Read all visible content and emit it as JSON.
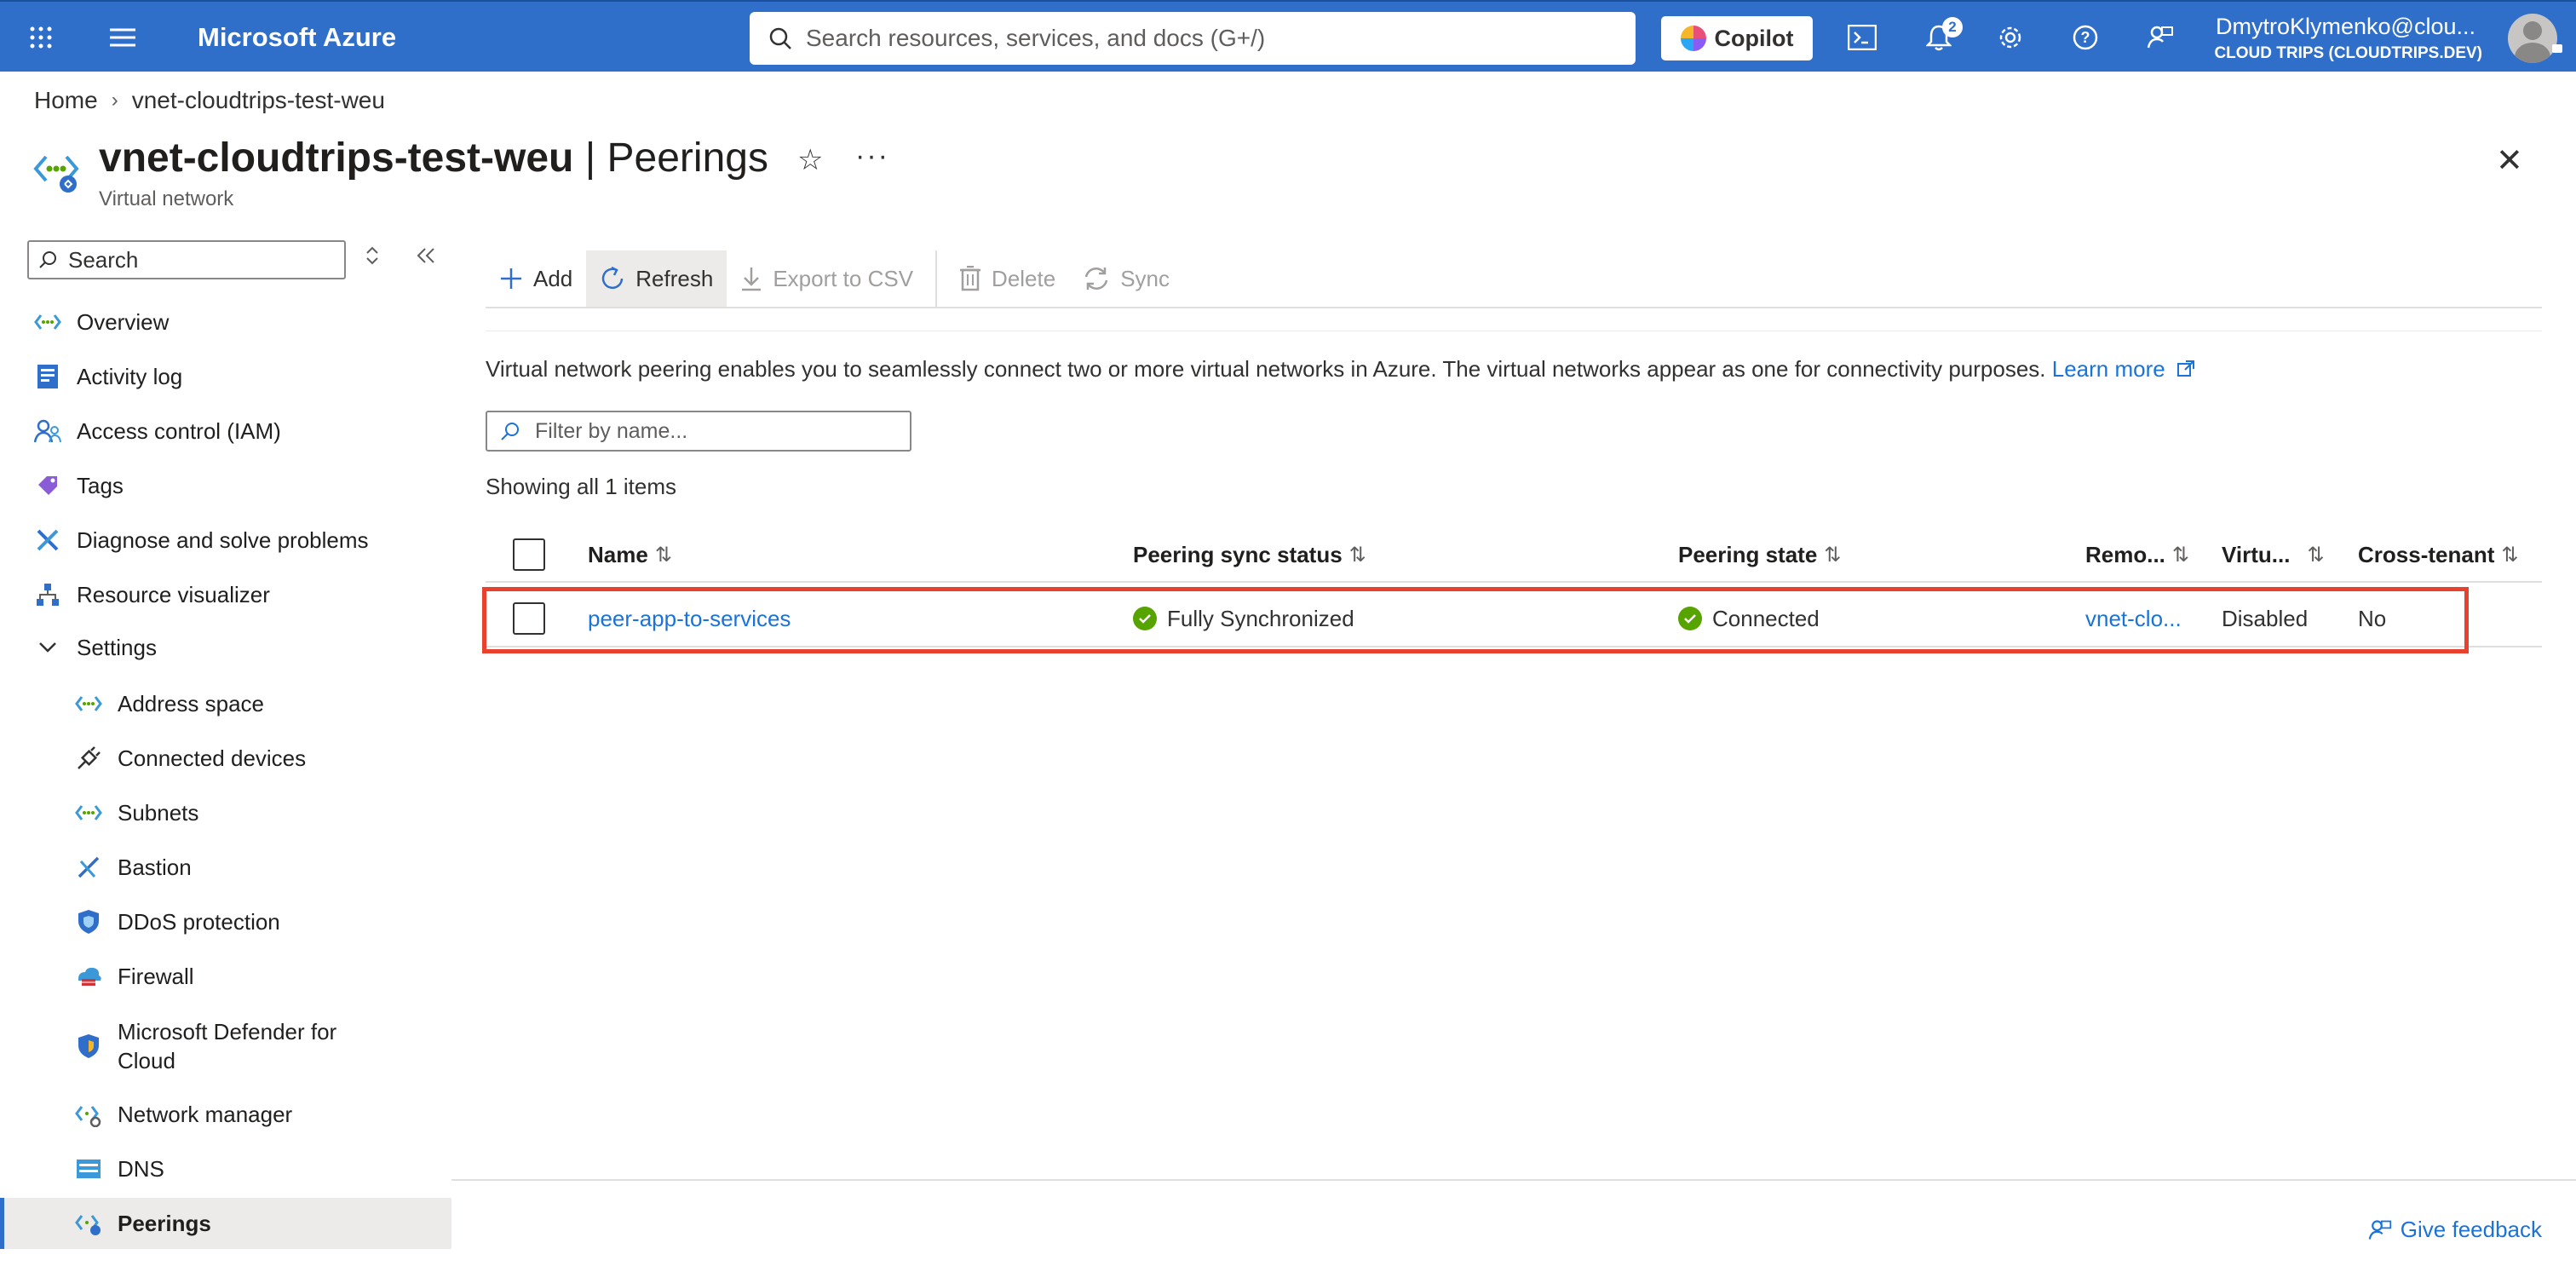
{
  "topbar": {
    "brand": "Microsoft Azure",
    "search_placeholder": "Search resources, services, and docs (G+/)",
    "copilot_label": "Copilot",
    "notification_count": "2",
    "user_name": "DmytroKlymenko@clou...",
    "tenant": "CLOUD TRIPS (CLOUDTRIPS.DEV)",
    "accent": "#2f6fca"
  },
  "breadcrumb": {
    "home": "Home",
    "current": "vnet-cloudtrips-test-weu"
  },
  "header": {
    "resource_name": "vnet-cloudtrips-test-weu",
    "divider": " | ",
    "blade_title": "Peerings",
    "subtitle": "Virtual network"
  },
  "sidebar": {
    "search_placeholder": "Search",
    "items": [
      {
        "label": "Overview",
        "icon": "vnet-icon"
      },
      {
        "label": "Activity log",
        "icon": "activity-log-icon"
      },
      {
        "label": "Access control (IAM)",
        "icon": "iam-icon"
      },
      {
        "label": "Tags",
        "icon": "tag-icon"
      },
      {
        "label": "Diagnose and solve problems",
        "icon": "wrench-icon"
      },
      {
        "label": "Resource visualizer",
        "icon": "visualizer-icon"
      },
      {
        "label": "Settings",
        "icon": "chevron-down-icon"
      },
      {
        "label": "Address space",
        "icon": "vnet-icon"
      },
      {
        "label": "Connected devices",
        "icon": "plug-icon"
      },
      {
        "label": "Subnets",
        "icon": "vnet-icon"
      },
      {
        "label": "Bastion",
        "icon": "bastion-icon"
      },
      {
        "label": "DDoS protection",
        "icon": "shield-icon"
      },
      {
        "label": "Firewall",
        "icon": "firewall-icon"
      },
      {
        "label": "Microsoft Defender for Cloud",
        "icon": "defender-icon"
      },
      {
        "label": "Network manager",
        "icon": "network-manager-icon"
      },
      {
        "label": "DNS",
        "icon": "dns-icon"
      },
      {
        "label": "Peerings",
        "icon": "peerings-icon"
      }
    ]
  },
  "toolbar": {
    "add": "Add",
    "refresh": "Refresh",
    "export": "Export to CSV",
    "delete": "Delete",
    "sync": "Sync"
  },
  "content": {
    "description": "Virtual network peering enables you to seamlessly connect two or more virtual networks in Azure. The virtual networks appear as one for connectivity purposes. ",
    "learn_more": "Learn more",
    "filter_placeholder": "Filter by name...",
    "showing": "Showing all 1 items"
  },
  "table": {
    "columns": [
      "Name",
      "Peering sync status",
      "Peering state",
      "Remo...",
      "Virtu...",
      "Cross-tenant"
    ],
    "rows": [
      {
        "name": "peer-app-to-services",
        "sync_status": "Fully Synchronized",
        "peering_state": "Connected",
        "remote": "vnet-clo...",
        "virtual": "Disabled",
        "cross_tenant": "No"
      }
    ]
  },
  "footer": {
    "feedback": "Give feedback"
  }
}
